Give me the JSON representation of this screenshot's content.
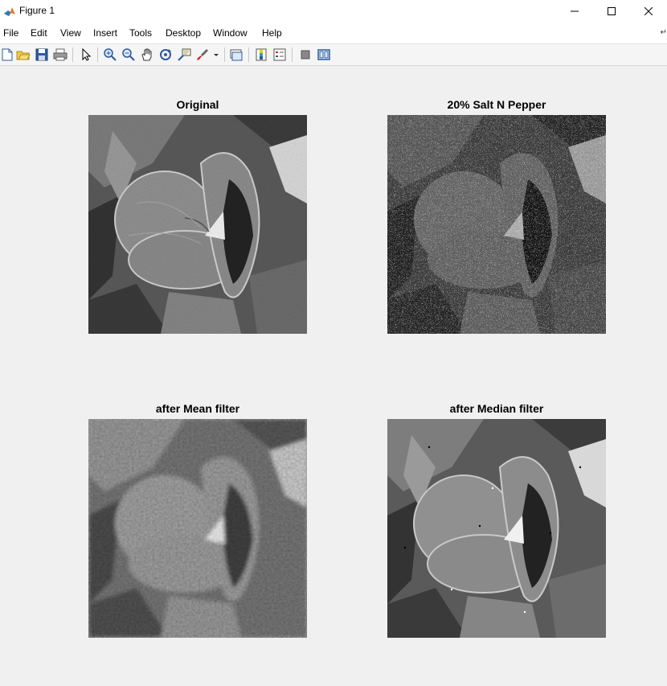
{
  "window": {
    "title": "Figure 1"
  },
  "menu": {
    "items": [
      "File",
      "Edit",
      "View",
      "Insert",
      "Tools",
      "Desktop",
      "Window",
      "Help"
    ]
  },
  "toolbar": {
    "icons": [
      "new-figure-icon",
      "open-file-icon",
      "save-icon",
      "print-icon",
      "pointer-icon",
      "zoom-in-icon",
      "zoom-out-icon",
      "pan-icon",
      "rotate-3d-icon",
      "data-cursor-icon",
      "brush-icon",
      "link-plot-icon",
      "colorbar-icon",
      "legend-icon",
      "hide-plot-tools-icon",
      "show-plot-tools-icon"
    ]
  },
  "subplots": [
    {
      "title": "Original",
      "image": "grayscale pansy flower"
    },
    {
      "title": "20% Salt N Pepper",
      "image": "grayscale pansy with salt and pepper noise"
    },
    {
      "title": "after Mean filter",
      "image": "grayscale pansy blurred by mean filter"
    },
    {
      "title": "after Median filter",
      "image": "grayscale pansy restored by median filter"
    }
  ],
  "colors": {
    "figure_background": "#f0f0f0",
    "titlebar": "#ffffff"
  }
}
